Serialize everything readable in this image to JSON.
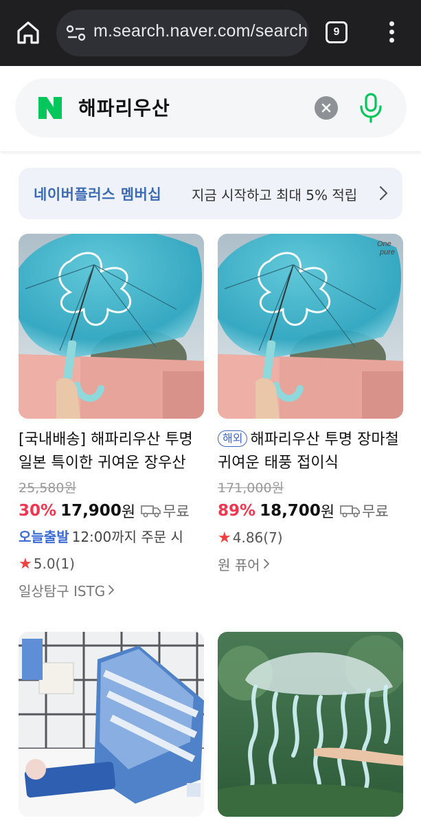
{
  "browser": {
    "url": "m.search.naver.com/search",
    "tab_count": "9",
    "icons": [
      "home-icon",
      "site-info-icon",
      "tab-switcher-icon",
      "more-menu-icon"
    ]
  },
  "search": {
    "query": "해파리우산",
    "logo_letter": "N",
    "icons": [
      "naver-logo-icon",
      "clear-icon",
      "mic-icon"
    ],
    "colors": {
      "brand": "#03c75a",
      "clear": "#8e9196"
    }
  },
  "banner": {
    "title": "네이버플러스 멤버십",
    "description": "지금 시작하고 최대 5% 적립"
  },
  "colors": {
    "discount": "#f2364f",
    "today_badge": "#3c6bd6",
    "star": "#f23f3f",
    "banner_bg": "#eff3f9"
  },
  "products": [
    {
      "title": "[국내배송] 해파리우산 투명 일본 특이한 귀여운 장우산",
      "original_price": "25,580원",
      "discount": "30%",
      "price": "17,900",
      "currency": "원",
      "shipping": "무료",
      "today_badge": "오늘출발",
      "today_desc": "12:00까지 주문 시",
      "rating": "5.0",
      "reviews": "(1)",
      "seller": "일상탐구 ISTG"
    },
    {
      "tag": "해외",
      "title": "해파리우산 투명 장마철 귀여운 태풍 접이식",
      "original_price": "171,000원",
      "discount": "89%",
      "price": "18,700",
      "currency": "원",
      "shipping": "무료",
      "rating": "4.86",
      "reviews": "(7)",
      "seller": "원 퓨어",
      "watermark": "One pure"
    },
    {
      "image": "blue-folding-umbrella"
    },
    {
      "image": "jellyfish-ribbon-umbrella"
    }
  ]
}
